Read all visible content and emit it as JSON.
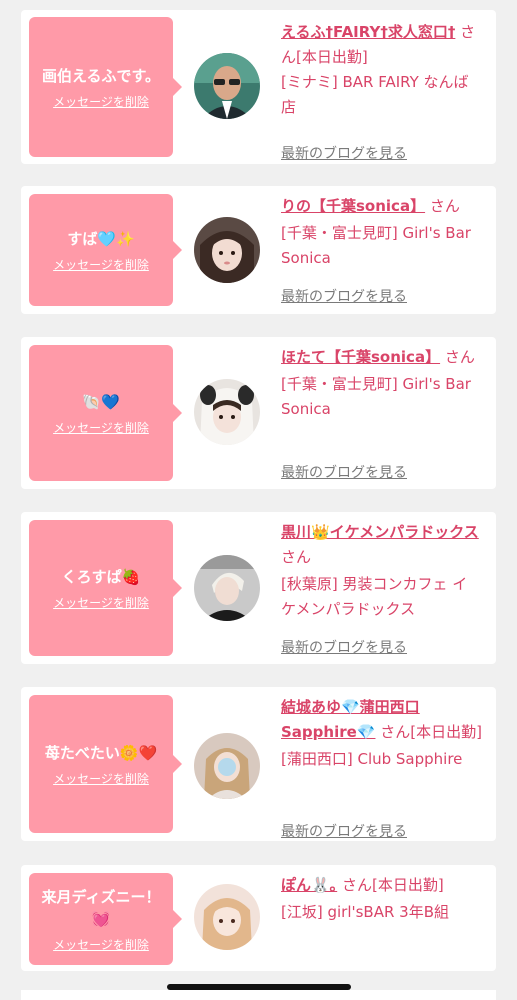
{
  "cards": [
    {
      "message": "画伯えるふです。",
      "delete_label": "メッセージを削除",
      "name": "えるふ†FAIRY†求人窓口†",
      "san": "さん[本日出勤]",
      "shop": "[ミナミ] BAR FAIRY なんば店",
      "blog_label": "最新のブログを見る"
    },
    {
      "message": "すば🩵✨",
      "delete_label": "メッセージを削除",
      "name": "りの【千葉sonica】",
      "san": "さん",
      "shop": "[千葉・富士見町] Girl's Bar Sonica",
      "blog_label": "最新のブログを見る"
    },
    {
      "message": "🐚💙",
      "delete_label": "メッセージを削除",
      "name": "ほたて【千葉sonica】",
      "san": "さん",
      "shop": "[千葉・富士見町] Girl's Bar Sonica",
      "blog_label": "最新のブログを見る"
    },
    {
      "message": "くろすぱ🍓",
      "delete_label": "メッセージを削除",
      "name": "黒川👑イケメンパラドックス",
      "san": "さん",
      "shop": "[秋葉原] 男装コンカフェ イケメンパラドックス",
      "blog_label": "最新のブログを見る"
    },
    {
      "message": "苺たべたい🌼❤️",
      "delete_label": "メッセージを削除",
      "name": "結城あゆ💎蒲田西口Sapphire💎",
      "san": "さん[本日出勤]",
      "shop": "[蒲田西口] Club Sapphire",
      "blog_label": "最新のブログを見る"
    },
    {
      "message": "来月ディズニー！💓",
      "delete_label": "メッセージを削除",
      "name": "ぽん🐰｡",
      "san": "さん[本日出勤]",
      "shop": "[江坂] girl'sBAR 3年B組",
      "blog_label": ""
    }
  ],
  "colors": {
    "bubble": "#ff9aa8",
    "accent_text": "#d94468",
    "link_gray": "#7a7a7a",
    "background": "#f0f0f0"
  }
}
